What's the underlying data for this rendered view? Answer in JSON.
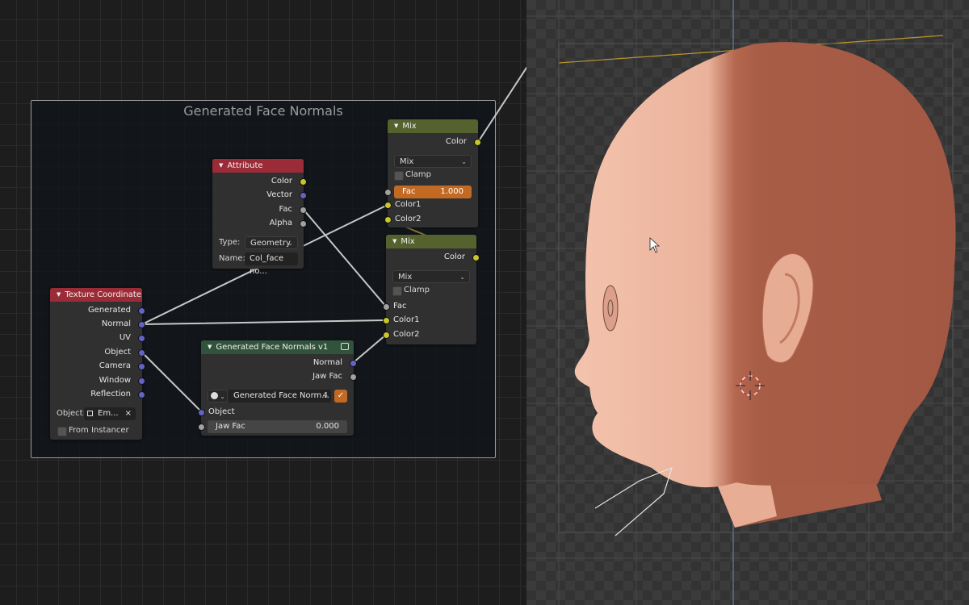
{
  "frame": {
    "label": "Generated Face Normals"
  },
  "nodes": {
    "attribute": {
      "title": "Attribute",
      "outputs": [
        "Color",
        "Vector",
        "Fac",
        "Alpha"
      ],
      "type_label": "Type:",
      "type_value": "Geometry",
      "name_label": "Name:",
      "name_value": "Col_face no..."
    },
    "texture_coordinate": {
      "title": "Texture Coordinate",
      "outputs": [
        "Generated",
        "Normal",
        "UV",
        "Object",
        "Camera",
        "Window",
        "Reflection"
      ],
      "object_label": "Object:",
      "object_value": "Em...",
      "from_instancer": "From Instancer"
    },
    "mix1": {
      "title": "Mix",
      "output": "Color",
      "blend": "Mix",
      "clamp": "Clamp",
      "fac_label": "Fac",
      "fac_value": "1.000",
      "inputs": [
        "Color1",
        "Color2"
      ]
    },
    "mix2": {
      "title": "Mix",
      "output": "Color",
      "blend": "Mix",
      "clamp": "Clamp",
      "inputs": [
        "Fac",
        "Color1",
        "Color2"
      ]
    },
    "group": {
      "title": "Generated Face Normals v1",
      "outputs": [
        "Normal",
        "Jaw Fac"
      ],
      "datablock_name": "Generated Face Norm...",
      "users": "4",
      "object_input": "Object",
      "jaw_fac_label": "Jaw Fac",
      "jaw_fac_value": "0.000"
    }
  },
  "colors": {
    "accent_orange": "#c26a23",
    "skin_light": "#f0b9a2",
    "skin_shadow": "#a85d47"
  }
}
